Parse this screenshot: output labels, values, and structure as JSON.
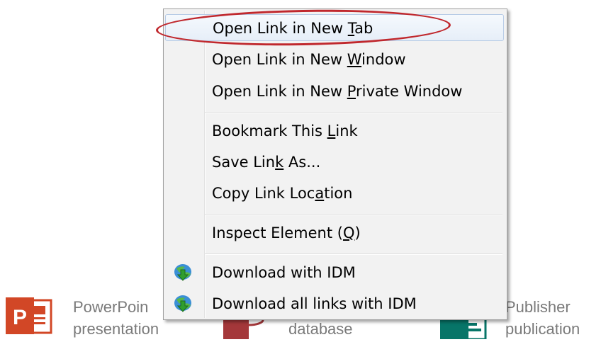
{
  "menu": {
    "items": [
      {
        "pre": "Open Link in New ",
        "key": "T",
        "post": "ab"
      },
      {
        "pre": "Open Link in New ",
        "key": "W",
        "post": "indow"
      },
      {
        "pre": "Open Link in New ",
        "key": "P",
        "post": "rivate Window"
      },
      {
        "pre": "Bookmark This ",
        "key": "L",
        "post": "ink"
      },
      {
        "pre": "Save Lin",
        "key": "k",
        "post": " As..."
      },
      {
        "pre": "Copy Link Loc",
        "key": "a",
        "post": "tion"
      },
      {
        "pre": "Inspect Element (",
        "key": "Q",
        "post": ")"
      },
      {
        "pre": "Download with IDM",
        "key": "",
        "post": ""
      },
      {
        "pre": "Download all links with IDM",
        "key": "",
        "post": ""
      }
    ],
    "icons": [
      "idm-download-icon",
      "idm-download-icon"
    ]
  },
  "background": {
    "ppt_line1": "PowerPoin",
    "ppt_line2": "presentation",
    "access_line2": "database",
    "pub_line1": "Publisher",
    "pub_line2": "publication",
    "colors": {
      "powerpoint": "#d24726",
      "access": "#a4373a",
      "publisher": "#077568"
    }
  },
  "annotation": {
    "ring_color": "#c0282d"
  }
}
